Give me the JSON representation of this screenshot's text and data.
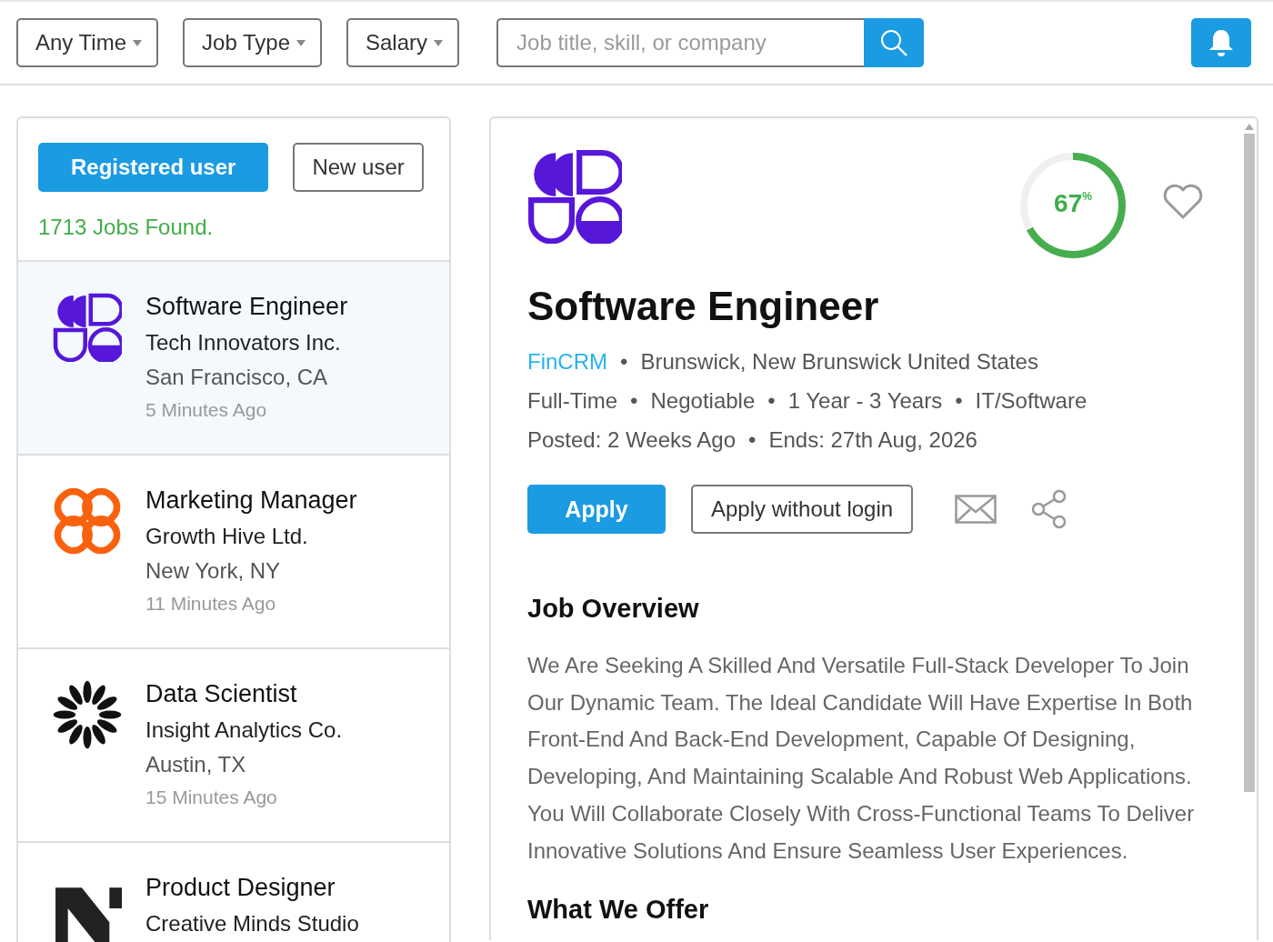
{
  "filters": [
    {
      "label": "Any Time"
    },
    {
      "label": "Job Type"
    },
    {
      "label": "Salary"
    }
  ],
  "search": {
    "placeholder": "Job title, skill, or company"
  },
  "sidebar": {
    "user_tabs": [
      {
        "label": "Registered user",
        "selected": true
      },
      {
        "label": "New user",
        "selected": false
      }
    ],
    "jobs_found": "1713 Jobs Found.",
    "jobs": [
      {
        "title": "Software Engineer",
        "company": "Tech Innovators Inc.",
        "location": "San Francisco, CA",
        "time": "5 Minutes Ago",
        "kind": "halves",
        "selected": true
      },
      {
        "title": "Marketing Manager",
        "company": "Growth Hive Ltd.",
        "location": "New York, NY",
        "time": "11 Minutes Ago",
        "kind": "flower",
        "selected": false
      },
      {
        "title": "Data Scientist",
        "company": "Insight Analytics Co.",
        "location": "Austin, TX",
        "time": "15 Minutes Ago",
        "kind": "burst",
        "selected": false
      },
      {
        "title": "Product Designer",
        "company": "Creative Minds Studio",
        "kind": "n",
        "selected": false
      }
    ]
  },
  "detail": {
    "logo": {
      "kind": "halves"
    },
    "separator": "•",
    "match": {
      "label": "67$^{%}$",
      "level": 0.67
    },
    "favorite": false,
    "title": "Software Engineer",
    "company": "FinCRM",
    "meta_lines": [
      [
        "Brunswick, New Brunswick United States"
      ],
      [
        "Full-Time",
        "Negotiable",
        "1 Year - 3 Years",
        "IT/Software"
      ],
      [
        "Posted: 2 Weeks Ago",
        "Ends: 27th Aug, 2026"
      ]
    ],
    "apply": "Apply",
    "apply_without_login": "Apply without login",
    "sections": [
      {
        "heading": "Job Overview",
        "body": "We Are Seeking A Skilled And Versatile Full-Stack Developer To Join Our Dynamic Team. The Ideal Candidate Will Have Expertise In Both Front-End And Back-End Development, Capable Of Designing, Developing, And Maintaining Scalable And Robust Web Applications. You Will Collaborate Closely With Cross-Functional Teams To Deliver Innovative Solutions And Ensure Seamless User Experiences."
      },
      {
        "heading": "What We Offer"
      }
    ]
  }
}
